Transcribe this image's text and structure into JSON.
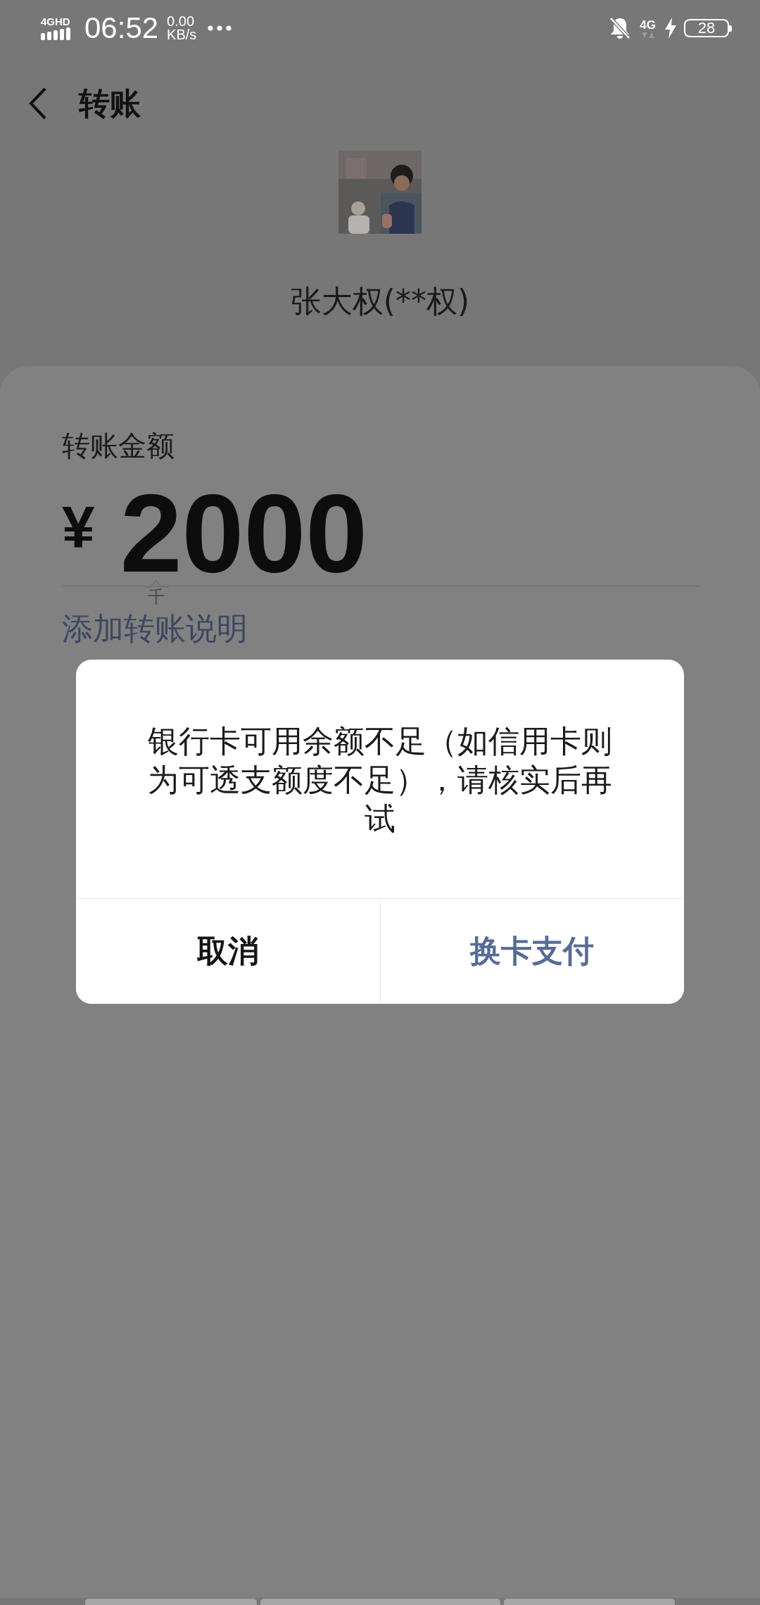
{
  "status_bar": {
    "network": "4GHD",
    "time": "06:52",
    "speed_value": "0.00",
    "speed_unit": "KB/s",
    "network_right": "4G",
    "battery": "28"
  },
  "header": {
    "title": "转账"
  },
  "recipient": {
    "name": "张大权(**权)"
  },
  "amount_card": {
    "label": "转账金额",
    "currency": "¥",
    "amount": "2000",
    "unit_hint": "千",
    "note_link": "添加转账说明"
  },
  "dialog": {
    "message": "银行卡可用余额不足（如信用卡则为可透支额度不足），请核实后再试",
    "buttons": [
      {
        "label": "取消",
        "kind": "cancel"
      },
      {
        "label": "换卡支付",
        "kind": "confirm"
      }
    ]
  },
  "bottom_keys": [
    {
      "kind": "key"
    },
    {
      "kind": "key"
    },
    {
      "kind": "key"
    }
  ]
}
